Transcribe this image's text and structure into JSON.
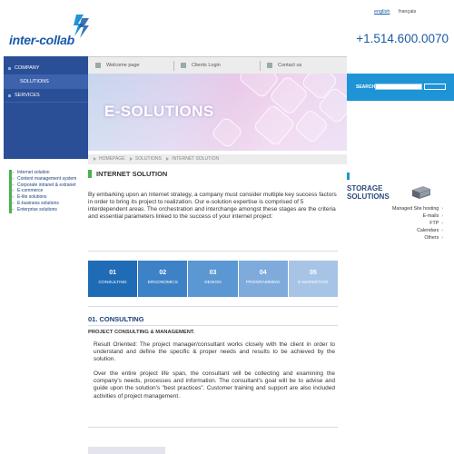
{
  "brand": {
    "logo_text": "inter-collab",
    "phone": "+1.514.600.0070",
    "colors": {
      "primary": "#1a5aa8",
      "nav": "#2b4f97",
      "accent_green": "#4ab34a",
      "accent_blue": "#1e94d6"
    }
  },
  "languages": {
    "english": "english",
    "french": "français"
  },
  "main_nav": {
    "items": [
      {
        "label": "COMPANY",
        "active": false
      },
      {
        "label": "SOLUTIONS",
        "active": true
      },
      {
        "label": "SERVICES",
        "active": false
      }
    ]
  },
  "top_tabs": [
    {
      "label": "Welcome page",
      "icon": "home-icon"
    },
    {
      "label": "Clients Login",
      "icon": "login-icon"
    },
    {
      "label": "Contact us",
      "icon": "mail-icon"
    }
  ],
  "banner": {
    "title": "E-SOLUTIONS"
  },
  "search": {
    "label": "SEARCH",
    "placeholder": ""
  },
  "breadcrumb": [
    "HOMEPAGE",
    "SOLUTIONS",
    "INTERNET SOLUTION"
  ],
  "sub_nav": {
    "items": [
      "Internet solution",
      "Content management system",
      "Corporate intranet & extranet",
      "E-commerce",
      "E-lite solutions",
      "E-business solutions",
      "Enterprise solutions"
    ]
  },
  "content": {
    "section_title": "INTERNET SOLUTION",
    "intro": "By embarking upon an Internet strategy, a company must consider multiple key success factors in order to bring its project to realization. Our e-solution expertise is comprised of 5 interdependent areas. The orchestration and interchange amongst these stages are the criteria and essential parameters linked to the success of your internet project:",
    "steps": [
      {
        "num": "01",
        "label": "CONSULTING",
        "color": "#1f6bb6"
      },
      {
        "num": "02",
        "label": "ERGONOMICS",
        "color": "#3d82c6"
      },
      {
        "num": "03",
        "label": "DESIGN",
        "color": "#5b97d2"
      },
      {
        "num": "04",
        "label": "PROGRAMMING",
        "color": "#7eabdc"
      },
      {
        "num": "05",
        "label": "E-MARKETING",
        "color": "#a7c4e6"
      }
    ],
    "heading": "01. CONSULTING",
    "subheading": "PROJECT CONSULTING & MANAGEMENT.",
    "para1": "Result Oriented: The project manager/consultant works closely with the client in order to understand and define the specific & proper needs and results to be achieved by the solution.",
    "para2": "Over the entire project life span, the consultant will be collecting and examining the company's needs, processes and information. The consultant's goal will be to advise and guide upon the solution's \"best practices\". Customer training and support are also included activities of project management."
  },
  "storage": {
    "title_line1": "STORAGE",
    "title_line2": "SOLUTIONS",
    "icon": "server-icon",
    "items": [
      "Managed Site hosting",
      "E-mails",
      "FTP",
      "Calendars",
      "Others"
    ]
  }
}
